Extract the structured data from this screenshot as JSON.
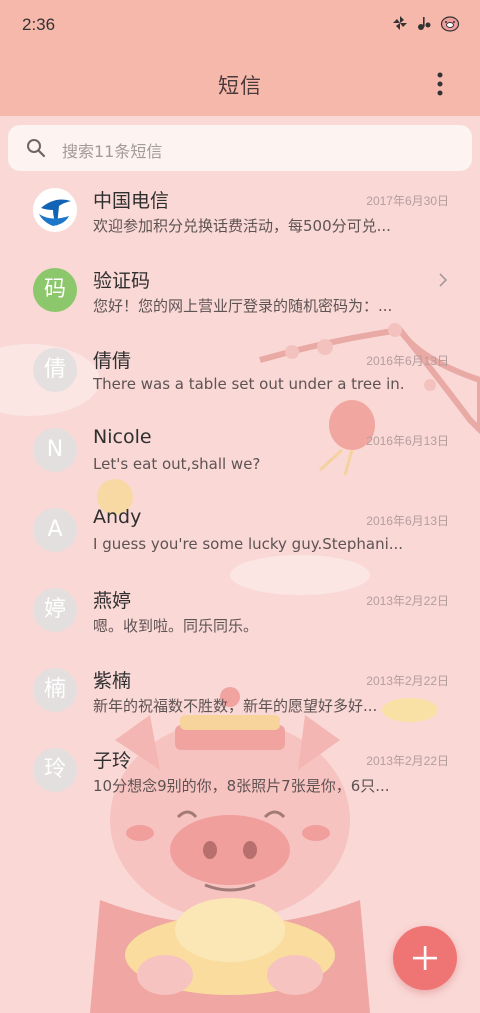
{
  "status": {
    "time": "2:36",
    "icons": [
      "pinwheel-icon",
      "music-icon",
      "pig-icon"
    ]
  },
  "header": {
    "title": "短信"
  },
  "search": {
    "placeholder": "搜索11条短信"
  },
  "conversations": [
    {
      "name": "中国电信",
      "date": "2017年6月30日",
      "preview": "欢迎参加积分兑换话费活动，每500分可兑...",
      "avatar": "",
      "avatar_type": "logo"
    },
    {
      "name": "验证码",
      "date": "",
      "preview": "您好！您的网上营业厅登录的随机密码为：...",
      "avatar": "码",
      "avatar_type": "green"
    },
    {
      "name": "倩倩",
      "date": "2016年6月13日",
      "preview": "There was a table set out under a tree in...",
      "avatar": "倩",
      "avatar_type": "gray"
    },
    {
      "name": "Nicole",
      "date": "2016年6月13日",
      "preview": "Let's eat out,shall we?",
      "avatar": "N",
      "avatar_type": "gray"
    },
    {
      "name": "Andy",
      "date": "2016年6月13日",
      "preview": "I guess you're some lucky guy.Stephani...",
      "avatar": "A",
      "avatar_type": "gray"
    },
    {
      "name": "燕婷",
      "date": "2013年2月22日",
      "preview": "嗯。收到啦。同乐同乐。",
      "avatar": "婷",
      "avatar_type": "gray"
    },
    {
      "name": "紫楠",
      "date": "2013年2月22日",
      "preview": "新年的祝福数不胜数，新年的愿望好多好...",
      "avatar": "楠",
      "avatar_type": "gray"
    },
    {
      "name": "子玲",
      "date": "2013年2月22日",
      "preview": "10分想念9别的你，8张照片7张是你，6只...",
      "avatar": "玲",
      "avatar_type": "gray"
    }
  ],
  "colors": {
    "header": "#f7b8ac",
    "background": "#f9d8d6",
    "fab": "#ef7575",
    "avatar_green": "#8cc86b"
  }
}
